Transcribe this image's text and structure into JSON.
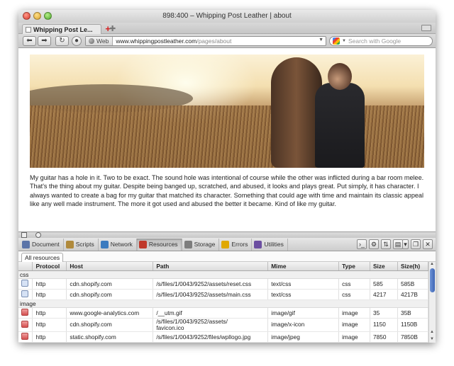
{
  "window": {
    "title": "898:400 – Whipping Post Leather | about",
    "tab_label": "Whipping Post Le...",
    "url_chip": "Web",
    "url_host": "www.whippingpostleather.com",
    "url_path": "/pages/about",
    "search_placeholder": "Search with Google"
  },
  "page": {
    "paragraph": "My guitar has a hole in it. Two to be exact.  The sound hole was intentional of course while the other was inflicted during a bar room melee.  That's the thing about my guitar.  Despite being banged up, scratched, and abused, it looks and plays great.  Put simply, it has character.  I always wanted to create a bag for my guitar that matched its character.  Something that could age with time and maintain its classic appeal like any well made instrument.  The more it got used and abused the better it became.  Kind of like my guitar."
  },
  "devtools": {
    "tabs": [
      {
        "label": "Document",
        "color": "#5b74a8"
      },
      {
        "label": "Scripts",
        "color": "#b08a3c"
      },
      {
        "label": "Network",
        "color": "#3b7bbf"
      },
      {
        "label": "Resources",
        "color": "#c0392b"
      },
      {
        "label": "Storage",
        "color": "#7d7d7d"
      },
      {
        "label": "Errors",
        "color": "#e0a800"
      },
      {
        "label": "Utilities",
        "color": "#6c4fa1"
      }
    ],
    "right_buttons": [
      "›_",
      "⚙",
      "⇅",
      "▤",
      "▾",
      "❐",
      "✕"
    ],
    "filter": "All resources",
    "columns": [
      "Protocol",
      "Host",
      "Path",
      "Mime",
      "Type",
      "Size",
      "Size(h)"
    ],
    "groups": [
      {
        "name": "css",
        "rows": [
          {
            "icon": "css",
            "protocol": "http",
            "host": "cdn.shopify.com",
            "path": "/s/files/1/0043/9252/assets/reset.css",
            "mime": "text/css",
            "type": "css",
            "size": "585",
            "sizeh": "585B"
          },
          {
            "icon": "css",
            "protocol": "http",
            "host": "cdn.shopify.com",
            "path": "/s/files/1/0043/9252/assets/main.css",
            "mime": "text/css",
            "type": "css",
            "size": "4217",
            "sizeh": "4217B"
          }
        ]
      },
      {
        "name": "image",
        "rows": [
          {
            "icon": "image",
            "protocol": "http",
            "host": "www.google-analytics.com",
            "path": "/__utm.gif",
            "mime": "image/gif",
            "type": "image",
            "size": "35",
            "sizeh": "35B"
          },
          {
            "icon": "image",
            "protocol": "http",
            "host": "cdn.shopify.com",
            "path": "/s/files/1/0043/9252/assets/\nfavicon.ico",
            "mime": "image/x-icon",
            "type": "image",
            "size": "1150",
            "sizeh": "1150B"
          },
          {
            "icon": "image",
            "protocol": "http",
            "host": "static.shopify.com",
            "path": "/s/files/1/0043/9252/files/wpllogo.jpg",
            "mime": "image/jpeg",
            "type": "image",
            "size": "7850",
            "sizeh": "7850B"
          }
        ]
      }
    ]
  }
}
